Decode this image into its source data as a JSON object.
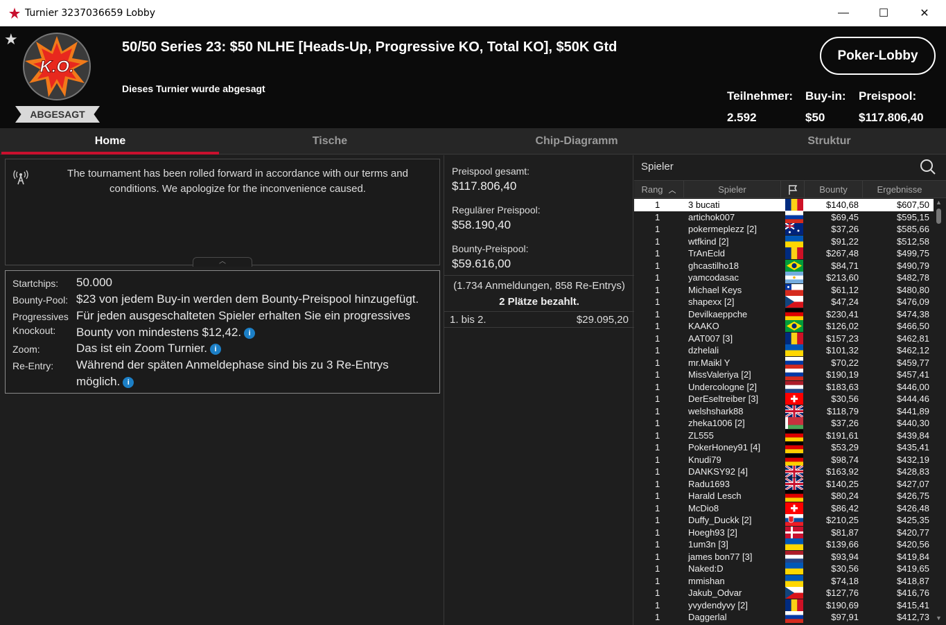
{
  "window": {
    "title": "Turnier 3237036659 Lobby",
    "minimize": "—",
    "maximize": "☐",
    "close": "✕"
  },
  "header": {
    "ko_badge": "K.O.",
    "status": "ABGESAGT",
    "title": "50/50 Series 23: $50 NLHE [Heads-Up, Progressive KO, Total KO], $50K Gtd",
    "subtitle": "Dieses Turnier wurde abgesagt",
    "lobby_button": "Poker-Lobby",
    "stats": {
      "players_label": "Teilnehmer:",
      "players_value": "2.592",
      "buyin_label": "Buy-in:",
      "buyin_value": "$50",
      "prize_label": "Preispool:",
      "prize_value": "$117.806,40"
    }
  },
  "tabs": [
    "Home",
    "Tische",
    "Chip-Diagramm",
    "Struktur"
  ],
  "notice": {
    "line1": "The tournament has been rolled forward in accordance with our terms and",
    "line2": "conditions. We apologize for the inconvenience caused."
  },
  "info": {
    "startchips_label": "Startchips:",
    "startchips_value": "50.000",
    "bountypool_label": "Bounty-Pool:",
    "bountypool_value": "$23 von jedem Buy-in werden dem Bounty-Preispool hinzugefügt.",
    "pko_label1": "Progressives",
    "pko_label2": "Knockout:",
    "pko_value1": "Für jeden ausgeschalteten Spieler erhalten Sie ein progressives",
    "pko_value2": "Bounty von mindestens $12,42.",
    "zoom_label": "Zoom:",
    "zoom_value": "Das ist ein Zoom Turnier.",
    "reentry_label": "Re-Entry:",
    "reentry_value1": "Während der späten Anmeldephase sind bis zu 3 Re-Entrys",
    "reentry_value2": "möglich.",
    "info_glyph": "i"
  },
  "prizepool": {
    "total_label": "Preispool gesamt:",
    "total_value": "$117.806,40",
    "regular_label": "Regulärer Preispool:",
    "regular_value": "$58.190,40",
    "bounty_label": "Bounty-Preispool:",
    "bounty_value": "$59.616,00",
    "entries": "(1.734 Anmeldungen, 858 Re-Entrys)",
    "paid": "2 Plätze bezahlt.",
    "payout_place": "1. bis 2.",
    "payout_amount": "$29.095,20"
  },
  "players": {
    "title": "Spieler",
    "columns": {
      "rank": "Rang",
      "name": "Spieler",
      "bounty": "Bounty",
      "results": "Ergebnisse"
    },
    "rows": [
      {
        "rank": "1",
        "name": "3 bucati",
        "flag": "ro",
        "bounty": "$140,68",
        "result": "$607,50"
      },
      {
        "rank": "1",
        "name": "artichok007",
        "flag": "ru",
        "bounty": "$69,45",
        "result": "$595,15"
      },
      {
        "rank": "1",
        "name": "pokermeplezz [2]",
        "flag": "au",
        "bounty": "$37,26",
        "result": "$585,66"
      },
      {
        "rank": "1",
        "name": "wtfkind [2]",
        "flag": "ua",
        "bounty": "$91,22",
        "result": "$512,58"
      },
      {
        "rank": "1",
        "name": "TrAnEcld",
        "flag": "ro",
        "bounty": "$267,48",
        "result": "$499,75"
      },
      {
        "rank": "1",
        "name": "ghcastilho18",
        "flag": "br",
        "bounty": "$84,71",
        "result": "$490,79"
      },
      {
        "rank": "1",
        "name": "yamcodasac",
        "flag": "ar",
        "bounty": "$213,60",
        "result": "$482,78"
      },
      {
        "rank": "1",
        "name": "Michael Keys",
        "flag": "cl",
        "bounty": "$61,12",
        "result": "$480,80"
      },
      {
        "rank": "1",
        "name": "shapexx [2]",
        "flag": "cz",
        "bounty": "$47,24",
        "result": "$476,09"
      },
      {
        "rank": "1",
        "name": "Devilkaeppche",
        "flag": "de",
        "bounty": "$230,41",
        "result": "$474,38"
      },
      {
        "rank": "1",
        "name": "KAAKO",
        "flag": "br",
        "bounty": "$126,02",
        "result": "$466,50"
      },
      {
        "rank": "1",
        "name": "AAT007 [3]",
        "flag": "ro",
        "bounty": "$157,23",
        "result": "$462,81"
      },
      {
        "rank": "1",
        "name": "dzhelali",
        "flag": "ua",
        "bounty": "$101,32",
        "result": "$462,12"
      },
      {
        "rank": "1",
        "name": "mr.Maikl Y",
        "flag": "ru",
        "bounty": "$70,22",
        "result": "$459,77"
      },
      {
        "rank": "1",
        "name": "MissValeriya [2]",
        "flag": "ru",
        "bounty": "$190,19",
        "result": "$457,41"
      },
      {
        "rank": "1",
        "name": "Undercologne [2]",
        "flag": "nl",
        "bounty": "$183,63",
        "result": "$446,00"
      },
      {
        "rank": "1",
        "name": "DerEseltreiber [3]",
        "flag": "ch",
        "bounty": "$30,56",
        "result": "$444,46"
      },
      {
        "rank": "1",
        "name": "welshshark88",
        "flag": "gb",
        "bounty": "$118,79",
        "result": "$441,89"
      },
      {
        "rank": "1",
        "name": "zheka1006 [2]",
        "flag": "by",
        "bounty": "$37,26",
        "result": "$440,30"
      },
      {
        "rank": "1",
        "name": "ZL555",
        "flag": "de",
        "bounty": "$191,61",
        "result": "$439,84"
      },
      {
        "rank": "1",
        "name": "PokerHoney91 [4]",
        "flag": "de",
        "bounty": "$53,29",
        "result": "$435,41"
      },
      {
        "rank": "1",
        "name": "Knudi79",
        "flag": "de",
        "bounty": "$98,74",
        "result": "$432,19"
      },
      {
        "rank": "1",
        "name": "DANKSY92 [4]",
        "flag": "gb",
        "bounty": "$163,92",
        "result": "$428,83"
      },
      {
        "rank": "1",
        "name": "Radu1693",
        "flag": "gb",
        "bounty": "$140,25",
        "result": "$427,07"
      },
      {
        "rank": "1",
        "name": "Harald Lesch",
        "flag": "de",
        "bounty": "$80,24",
        "result": "$426,75"
      },
      {
        "rank": "1",
        "name": "McDio8",
        "flag": "ch",
        "bounty": "$86,42",
        "result": "$426,48"
      },
      {
        "rank": "1",
        "name": "Duffy_Duckk [2]",
        "flag": "sk",
        "bounty": "$210,25",
        "result": "$425,35"
      },
      {
        "rank": "1",
        "name": "Hoegh93 [2]",
        "flag": "dk",
        "bounty": "$81,87",
        "result": "$420,77"
      },
      {
        "rank": "1",
        "name": "1um3n [3]",
        "flag": "ua",
        "bounty": "$139,66",
        "result": "$420,56"
      },
      {
        "rank": "1",
        "name": "james bon77 [3]",
        "flag": "nl",
        "bounty": "$93,94",
        "result": "$419,84"
      },
      {
        "rank": "1",
        "name": "Naked:D",
        "flag": "ua",
        "bounty": "$30,56",
        "result": "$419,65"
      },
      {
        "rank": "1",
        "name": "mmishan",
        "flag": "ua",
        "bounty": "$74,18",
        "result": "$418,87"
      },
      {
        "rank": "1",
        "name": "Jakub_Odvar",
        "flag": "cz",
        "bounty": "$127,76",
        "result": "$416,76"
      },
      {
        "rank": "1",
        "name": "yvydendyvy [2]",
        "flag": "ro",
        "bounty": "$190,69",
        "result": "$415,41"
      },
      {
        "rank": "1",
        "name": "Daggerlal",
        "flag": "ru",
        "bounty": "$97,91",
        "result": "$412,73"
      }
    ]
  },
  "colors": {
    "accent": "#c8102e",
    "info": "#1c7fc6",
    "selected_row": "#ffffff"
  }
}
